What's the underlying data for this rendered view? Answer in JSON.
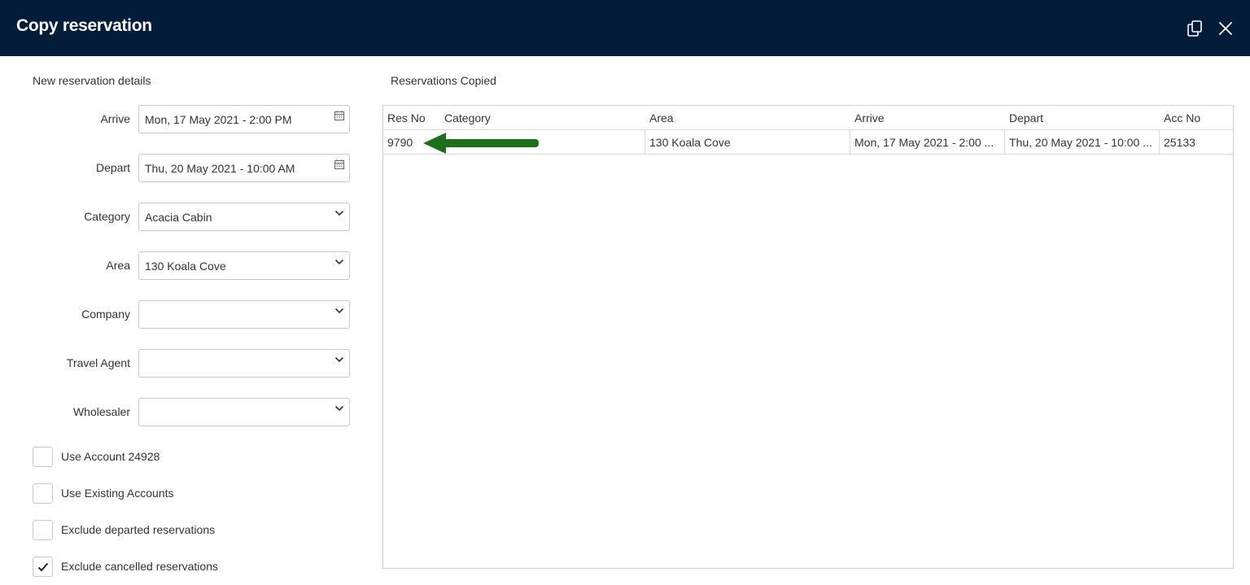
{
  "header": {
    "title": "Copy reservation"
  },
  "left_panel": {
    "section_title": "New reservation details",
    "fields": [
      {
        "label": "Arrive",
        "value": "Mon, 17 May 2021 - 2:00 PM",
        "icon": "calendar-icon"
      },
      {
        "label": "Depart",
        "value": "Thu, 20 May 2021 - 10:00 AM",
        "icon": "calendar-icon"
      },
      {
        "label": "Category",
        "value": "Acacia Cabin",
        "icon": "chevron-down-icon"
      },
      {
        "label": "Area",
        "value": "130 Koala Cove",
        "icon": "chevron-down-icon"
      },
      {
        "label": "Company",
        "value": "",
        "icon": "chevron-down-icon"
      },
      {
        "label": "Travel Agent",
        "value": "",
        "icon": "chevron-down-icon"
      },
      {
        "label": "Wholesaler",
        "value": "",
        "icon": "chevron-down-icon"
      }
    ],
    "checkboxes": [
      {
        "label": "Use Account 24928",
        "checked": false
      },
      {
        "label": "Use Existing Accounts",
        "checked": false
      },
      {
        "label": "Exclude departed reservations",
        "checked": false
      },
      {
        "label": "Exclude cancelled reservations",
        "checked": true
      }
    ]
  },
  "right_panel": {
    "section_title": "Reservations Copied",
    "columns": [
      "Res No",
      "Category",
      "Area",
      "Arrive",
      "Depart",
      "Acc No"
    ],
    "rows": [
      {
        "res_no": "9790",
        "category": "",
        "area": "130 Koala Cove",
        "arrive": "Mon, 17 May 2021 - 2:00 ...",
        "depart": "Thu, 20 May 2021 - 10:00 ...",
        "acc_no": "25133"
      }
    ]
  },
  "annotation": {
    "arrow_color": "#1e6e1e",
    "icon": "arrow-left-icon"
  },
  "colors": {
    "header_bg": "#021c3a",
    "header_text": "#ffffff",
    "border": "#c8c8c8"
  }
}
